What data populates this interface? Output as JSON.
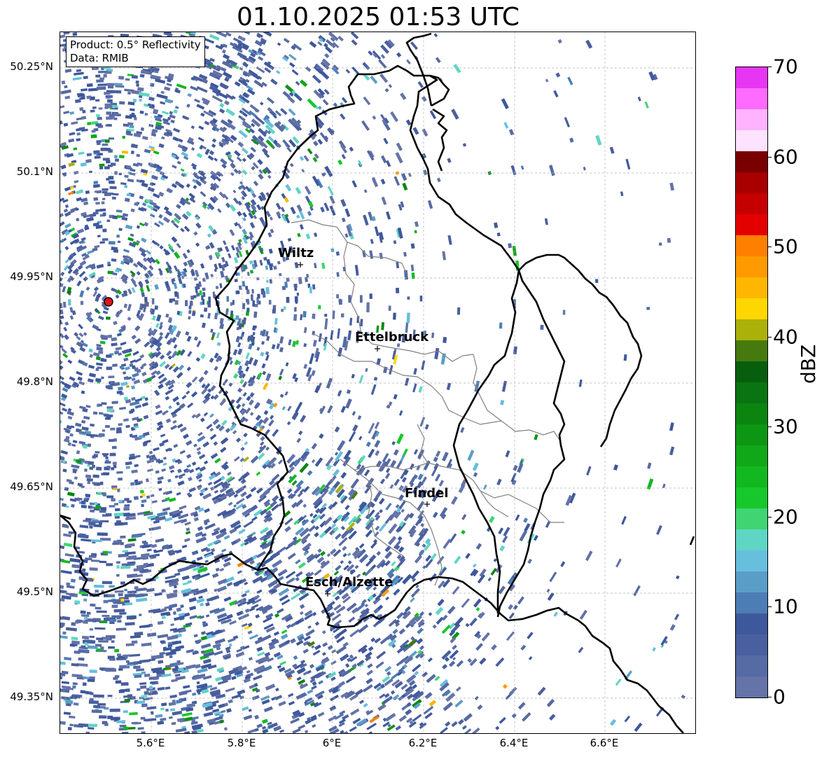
{
  "title": "01.10.2025 01:53 UTC",
  "info_box": {
    "product": "Product: 0.5° Reflectivity",
    "data": "Data: RMIB"
  },
  "lat_labels": [
    "50.25°N",
    "50.1°N",
    "49.95°N",
    "49.8°N",
    "49.65°N",
    "49.5°N",
    "49.35°N"
  ],
  "lon_labels": [
    "5.6°E",
    "5.8°E",
    "6°E",
    "6.2°E",
    "6.4°E",
    "6.6°E"
  ],
  "cities": [
    {
      "name": "Wiltz",
      "lon": 5.93,
      "lat": 49.97
    },
    {
      "name": "Ettelbruck",
      "lon": 6.1,
      "lat": 49.85
    },
    {
      "name": "Findel",
      "lon": 6.21,
      "lat": 49.63
    },
    {
      "name": "Esch/Alzette",
      "lon": 5.99,
      "lat": 49.5
    }
  ],
  "radar_site": {
    "lon": 5.505,
    "lat": 49.914
  },
  "colorbar": {
    "label": "dBZ",
    "ticks": [
      "0",
      "10",
      "20",
      "30",
      "40",
      "50",
      "60",
      "70"
    ],
    "colors": [
      "#6473a8",
      "#566aa3",
      "#4a5f9f",
      "#3e589c",
      "#4d7db5",
      "#5a9ec8",
      "#66bfdc",
      "#5fd6c4",
      "#40d473",
      "#16c82b",
      "#12b81f",
      "#10a719",
      "#0d9614",
      "#0b8510",
      "#097411",
      "#075f0d",
      "#467a0e",
      "#acb10a",
      "#ffd700",
      "#ffb600",
      "#ff9a00",
      "#ff7f00",
      "#e40000",
      "#c60000",
      "#a80000",
      "#7a0000",
      "#fde3ff",
      "#ffb3ff",
      "#ff6aff",
      "#e636f3"
    ]
  },
  "colors": {
    "echo_weak": "#5a72a8",
    "border_country": "#000000",
    "border_canton": "#808080",
    "radar_site": "#e0141e"
  }
}
